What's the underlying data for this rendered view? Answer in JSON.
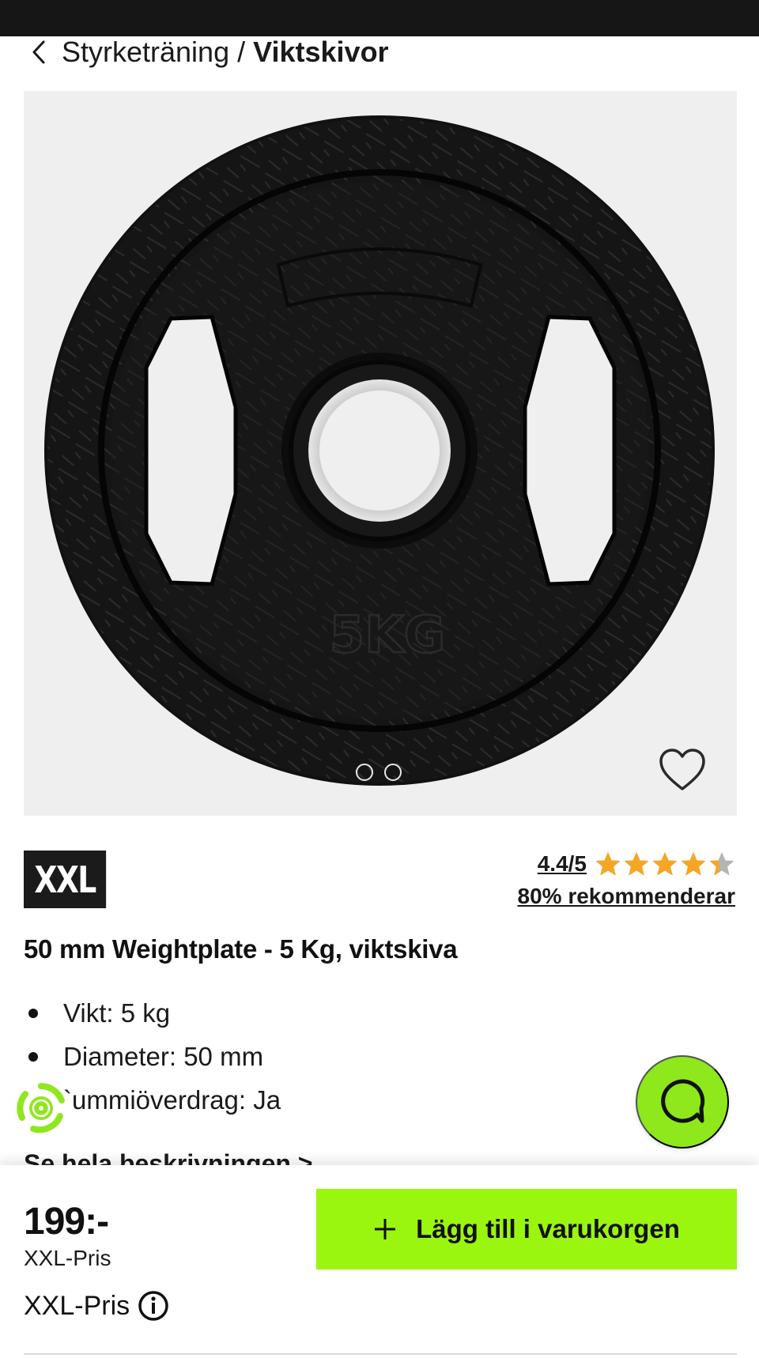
{
  "breadcrumb": {
    "parent": "Styrketräning",
    "separator": "/",
    "current": "Viktskivor",
    "back_icon": "chevron-left-icon"
  },
  "gallery": {
    "plate_marking": "5KG",
    "image_count": 2,
    "active_index": 0,
    "favorite_icon": "heart-outline-icon"
  },
  "brand": {
    "logo_text": "XXL"
  },
  "rating": {
    "score_text": "4.4/5",
    "score": 4.4,
    "max": 5,
    "recommend_text": "80% rekommenderar",
    "star_color": "#f6a623"
  },
  "product": {
    "title": "50 mm Weightplate - 5 Kg, viktskiva",
    "features": [
      "Vikt: 5 kg",
      "Diameter: 50 mm",
      "`ummiöverdrag: Ja"
    ],
    "see_more": "Se hela beskrivningen >"
  },
  "footer": {
    "price": "199:-",
    "price_label": "XXL-Pris",
    "price_label_2": "XXL-Pris",
    "add_to_cart": "Lägg till i varukorgen",
    "info_icon": "info-icon"
  },
  "colors": {
    "accent": "#9af50f",
    "chat_bg": "#8ee81c",
    "status_bar": "#161616"
  }
}
